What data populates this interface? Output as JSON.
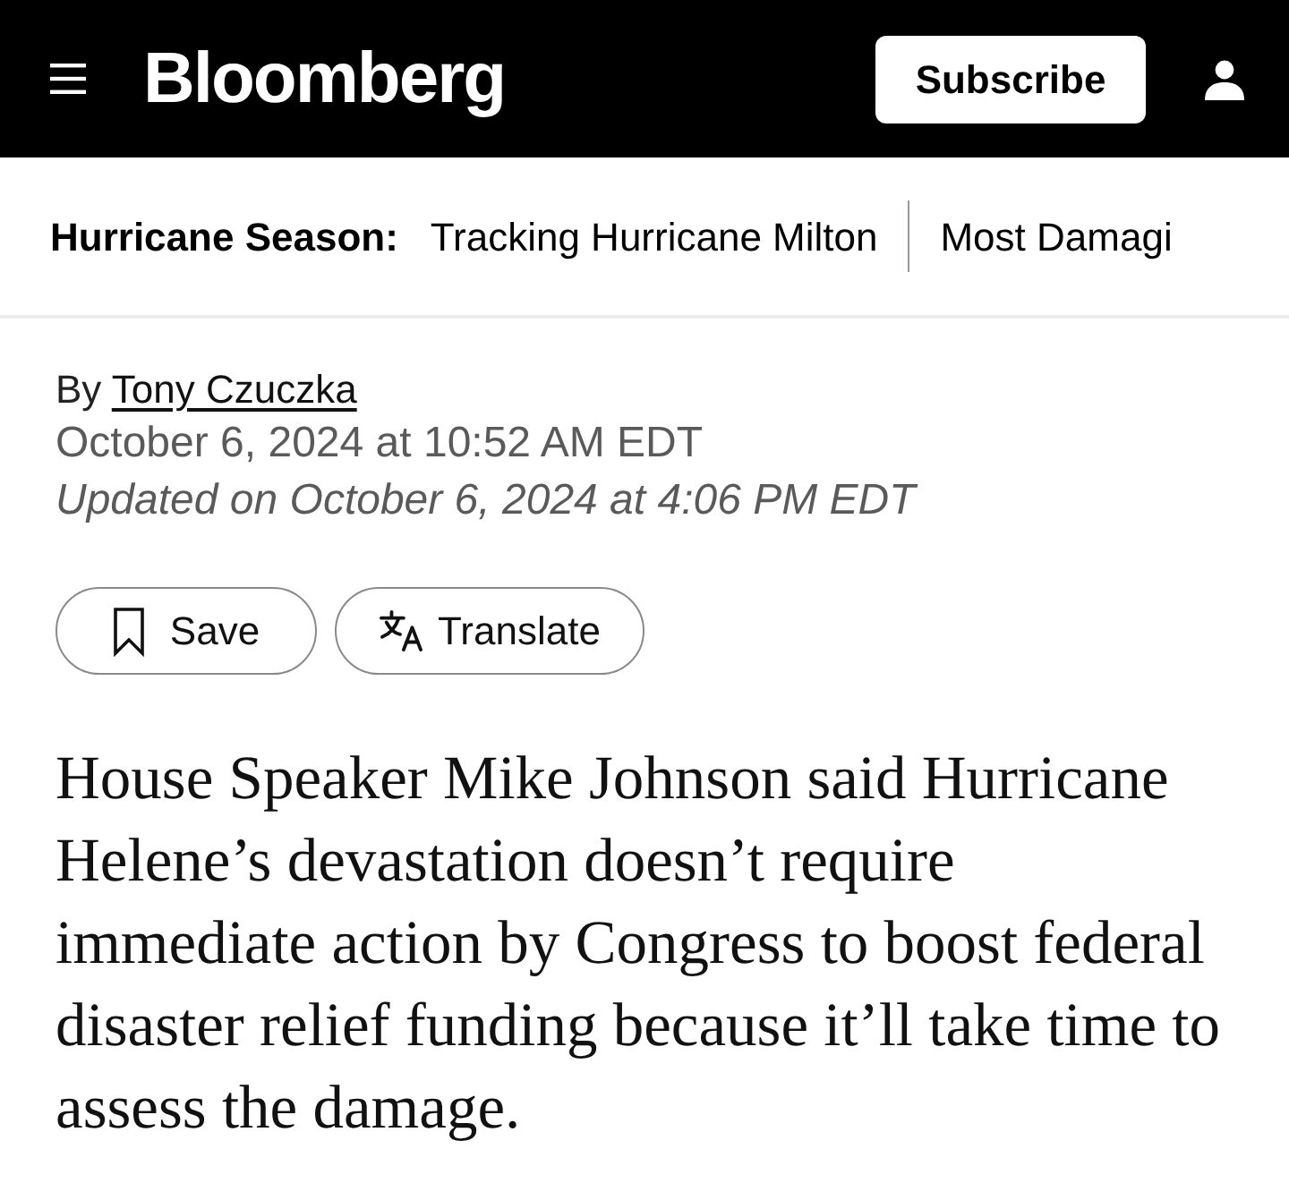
{
  "header": {
    "logo": "Bloomberg",
    "subscribe_button": "Subscribe"
  },
  "topic_bar": {
    "label": "Hurricane Season:",
    "links": [
      "Tracking Hurricane Milton",
      "Most Damagi"
    ]
  },
  "byline": {
    "prefix": "By",
    "author": "Tony Czuczka"
  },
  "published": "October 6, 2024 at 10:52 AM EDT",
  "updated": "Updated on October 6, 2024 at 4:06 PM EDT",
  "actions": [
    {
      "kind": "save",
      "label": "Save"
    },
    {
      "kind": "translate",
      "label": "Translate"
    }
  ],
  "summary": "House Speaker Mike Johnson said Hurricane Helene’s devastation doesn’t require immediate action by Congress to boost federal disaster relief funding because it’ll take time to assess the damage."
}
